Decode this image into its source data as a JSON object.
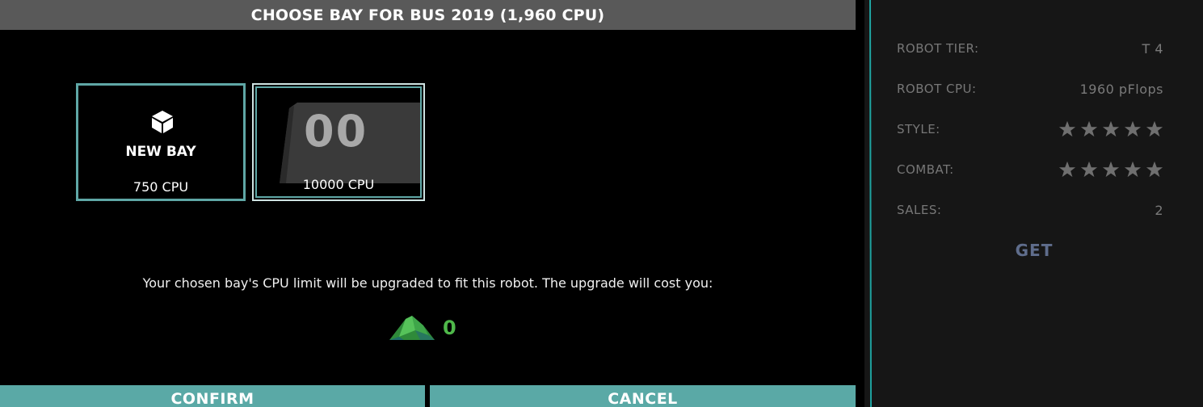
{
  "dialog": {
    "title": "CHOOSE BAY FOR BUS 2019 (1,960 CPU)",
    "bays": [
      {
        "label": "NEW BAY",
        "cpu": "750 CPU",
        "icon": "cube-icon"
      },
      {
        "preview_text": "00",
        "cpu": "10000 CPU"
      }
    ],
    "info_text": "Your chosen bay's CPU limit will be upgraded to fit this robot. The upgrade will cost you:",
    "cost": {
      "value": "0",
      "icon": "robits-currency-icon"
    },
    "buttons": {
      "confirm": "CONFIRM",
      "cancel": "CANCEL"
    }
  },
  "side_panel": {
    "stats": [
      {
        "label": "ROBOT TIER:",
        "value": "T 4"
      },
      {
        "label": "ROBOT CPU:",
        "value": "1960 pFlops"
      },
      {
        "label": "STYLE:",
        "stars": 5
      },
      {
        "label": "COMBAT:",
        "stars": 5
      },
      {
        "label": "SALES:",
        "value": "2"
      }
    ],
    "get_label": "GET"
  },
  "colors": {
    "accent": "#5aa9a6",
    "title_bar": "#595959",
    "cost_green": "#4fb84a",
    "get_text": "#5f6d8c"
  }
}
